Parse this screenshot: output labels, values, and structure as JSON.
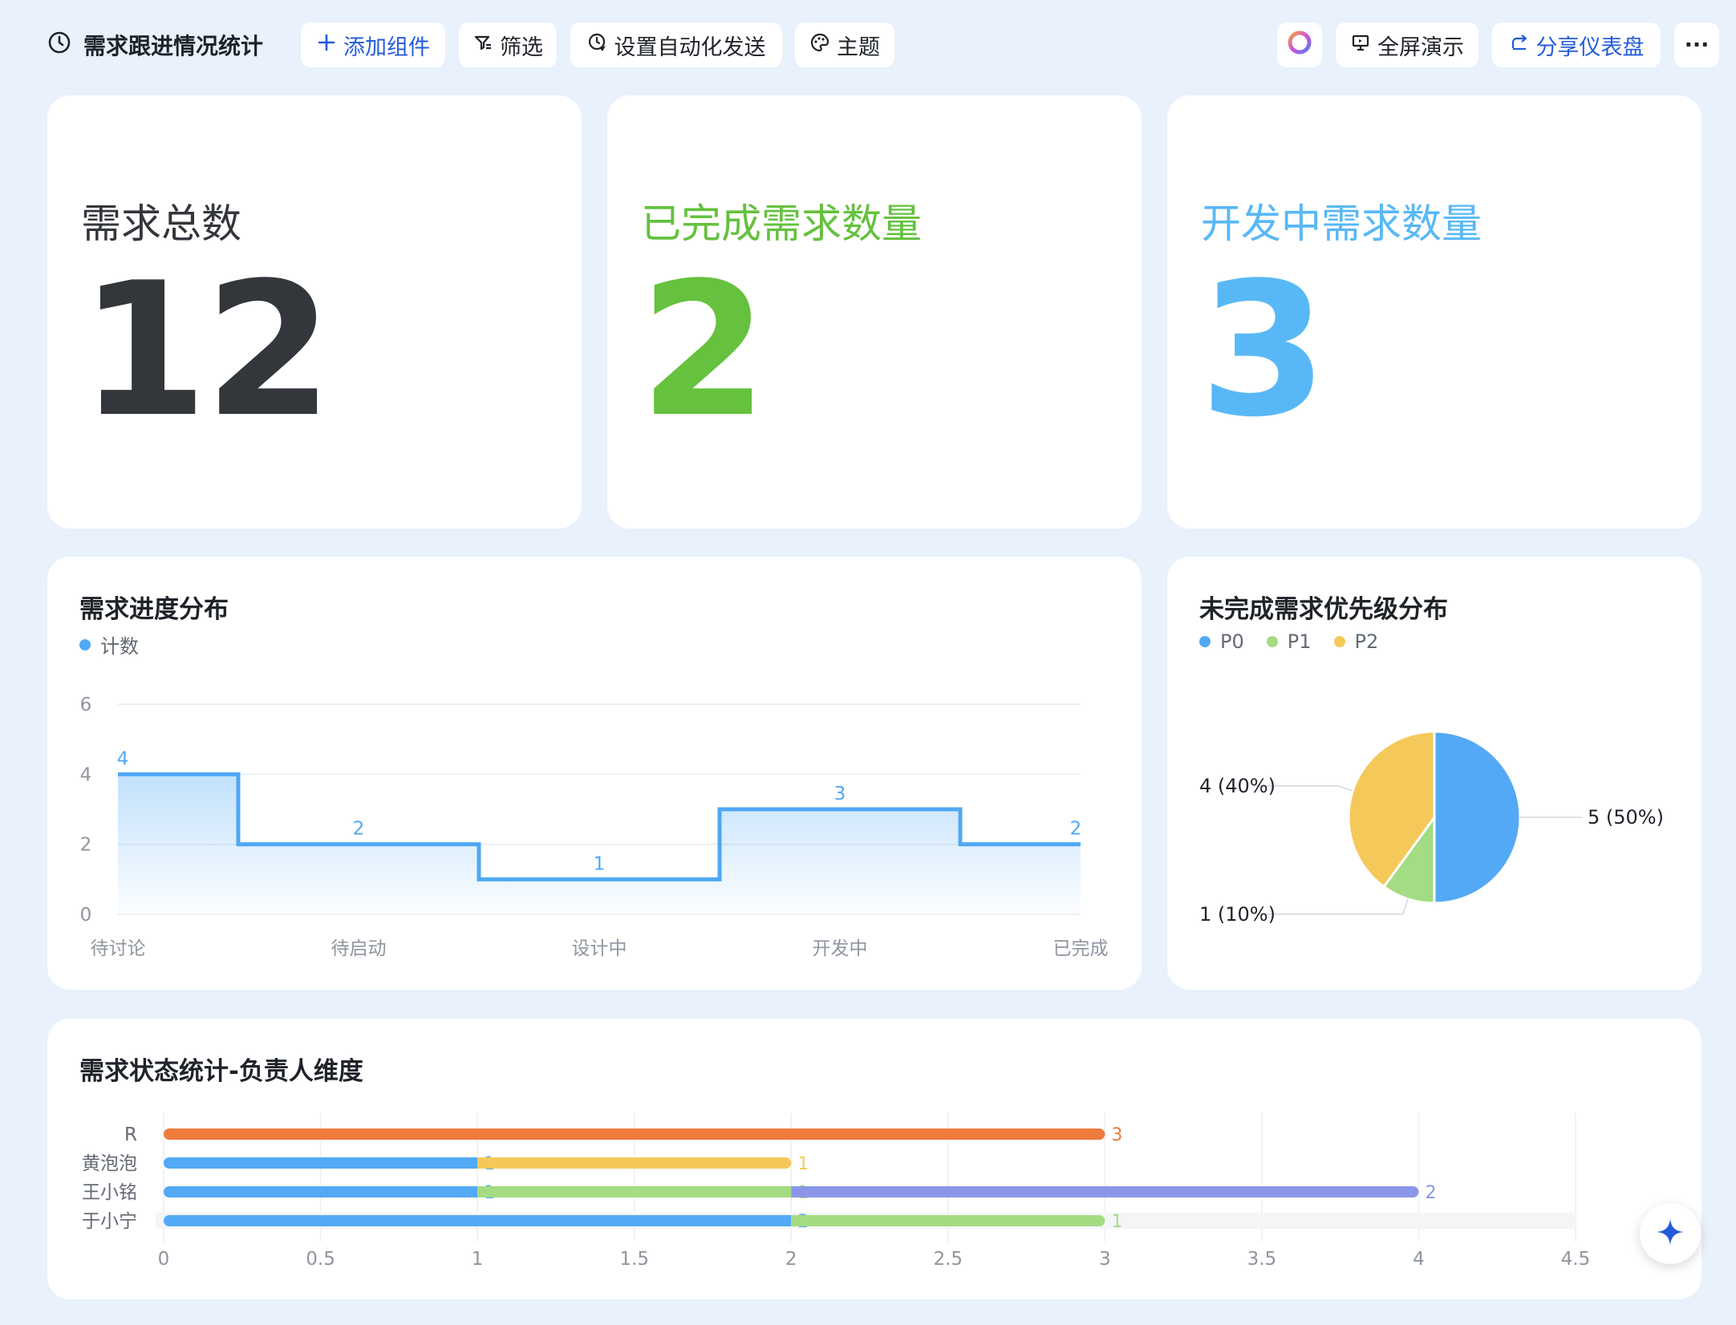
{
  "toolbar": {
    "title": "需求跟进情况统计",
    "add_widget": "添加组件",
    "filter": "筛选",
    "auto_send": "设置自动化发送",
    "theme": "主题",
    "fullscreen": "全屏演示",
    "share": "分享仪表盘",
    "more": "···"
  },
  "kpis": [
    {
      "label": "需求总数",
      "value": "12",
      "color": "#33363b"
    },
    {
      "label": "已完成需求数量",
      "value": "2",
      "color": "#65c13e"
    },
    {
      "label": "开发中需求数量",
      "value": "3",
      "color": "#58b8f6"
    }
  ],
  "charts": {
    "progress_title": "需求进度分布",
    "priority_title": "未完成需求优先级分布",
    "owner_title": "需求状态统计-负责人维度"
  },
  "chart_data": [
    {
      "type": "line",
      "title": "需求进度分布",
      "step": true,
      "area_fill": true,
      "categories": [
        "待讨论",
        "待启动",
        "设计中",
        "开发中",
        "已完成"
      ],
      "series": [
        {
          "name": "计数",
          "values": [
            4,
            2,
            1,
            3,
            2
          ],
          "color": "#4fa8f5"
        }
      ],
      "ylim": [
        0,
        6
      ],
      "yticks": [
        "0",
        "2",
        "4",
        "6"
      ],
      "grid": true,
      "legend": "top-left"
    },
    {
      "type": "pie",
      "title": "未完成需求优先级分布",
      "slices": [
        {
          "name": "P0",
          "value": 5,
          "label": "5 (50%)",
          "color": "#53a9f5"
        },
        {
          "name": "P1",
          "value": 1,
          "label": "1 (10%)",
          "color": "#a3dc82"
        },
        {
          "name": "P2",
          "value": 4,
          "label": "4 (40%)",
          "color": "#f5c959"
        }
      ],
      "legend": "top-left"
    },
    {
      "type": "bar",
      "orientation": "horizontal",
      "stacked": true,
      "title": "需求状态统计-负责人维度",
      "categories": [
        "R",
        "黄泡泡",
        "王小铭",
        "于小宁"
      ],
      "segments": [
        [
          {
            "value": 3,
            "color": "#ee7a3c"
          }
        ],
        [
          {
            "value": 1,
            "color": "#53a9f5"
          },
          {
            "value": 1,
            "color": "#f5c959"
          }
        ],
        [
          {
            "value": 1,
            "color": "#53a9f5"
          },
          {
            "value": 1,
            "color": "#a3dc82"
          },
          {
            "value": 2,
            "color": "#8b96e9"
          }
        ],
        [
          {
            "value": 2,
            "color": "#53a9f5"
          },
          {
            "value": 1,
            "color": "#a3dc82"
          }
        ]
      ],
      "xlim": [
        0,
        4.5
      ],
      "xticks": [
        "0",
        "0.5",
        "1",
        "1.5",
        "2",
        "2.5",
        "3",
        "3.5",
        "4",
        "4.5"
      ],
      "grid": true
    }
  ]
}
